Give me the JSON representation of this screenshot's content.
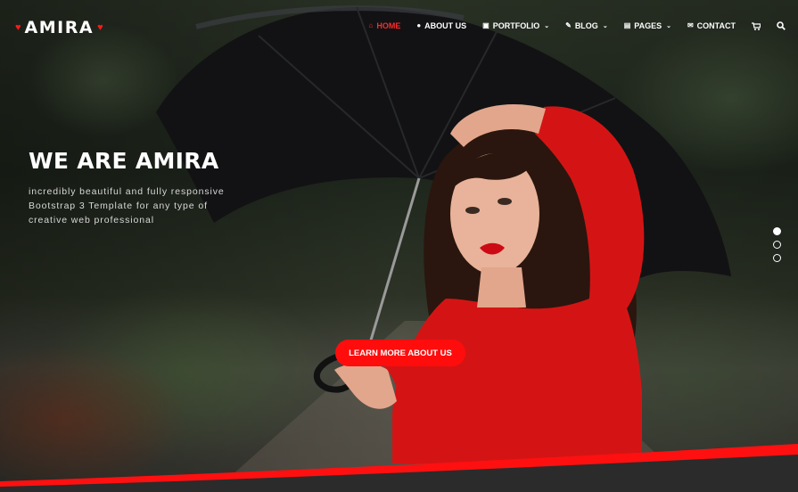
{
  "brand": {
    "name": "AMIRA",
    "heart_glyph": "♥",
    "accent_color": "#ff1a1a"
  },
  "nav": {
    "items": [
      {
        "label": "HOME",
        "icon": "home-icon",
        "glyph": "⌂",
        "active": true,
        "dropdown": false
      },
      {
        "label": "ABOUT US",
        "icon": "user-icon",
        "glyph": "●",
        "active": false,
        "dropdown": false
      },
      {
        "label": "PORTFOLIO",
        "icon": "image-icon",
        "glyph": "▣",
        "active": false,
        "dropdown": true
      },
      {
        "label": "BLOG",
        "icon": "edit-icon",
        "glyph": "✎",
        "active": false,
        "dropdown": true
      },
      {
        "label": "PAGES",
        "icon": "file-icon",
        "glyph": "▤",
        "active": false,
        "dropdown": true
      },
      {
        "label": "CONTACT",
        "icon": "envelope-icon",
        "glyph": "✉",
        "active": false,
        "dropdown": false
      }
    ],
    "caret_glyph": "⌄",
    "cart_icon": "cart-icon",
    "search_icon": "search-icon"
  },
  "hero": {
    "headline": "WE ARE AMIRA",
    "subtext": "incredibly beautiful and fully responsive Bootstrap 3 Template for any type of creative web professional",
    "cta_label": "LEARN MORE ABOUT US",
    "cta_color": "#ff0d0d"
  },
  "slider": {
    "slide_count": 3,
    "active_index": 0
  }
}
